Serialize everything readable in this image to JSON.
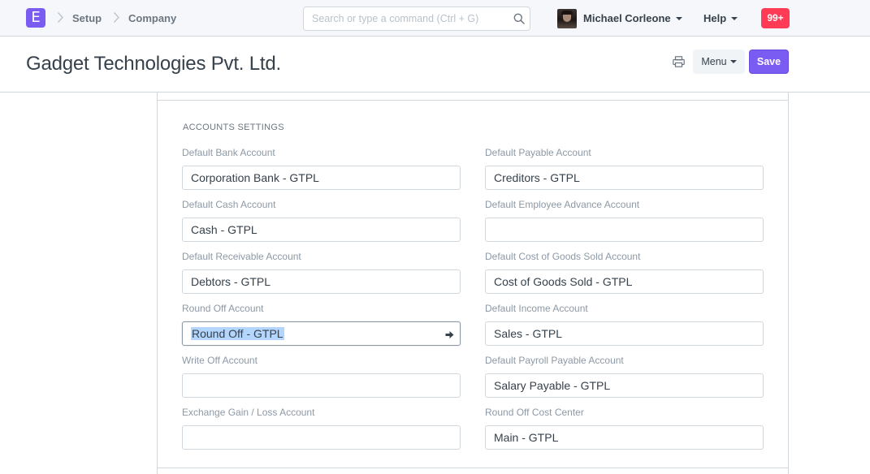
{
  "navbar": {
    "logo_letter": "E",
    "breadcrumbs": [
      "Setup",
      "Company"
    ],
    "search_placeholder": "Search or type a command (Ctrl + G)",
    "user_name": "Michael Corleone",
    "help_label": "Help",
    "notification_count": "99+"
  },
  "page": {
    "title": "Gadget Technologies Pvt. Ltd.",
    "menu_label": "Menu",
    "save_label": "Save"
  },
  "section": {
    "title": "ACCOUNTS SETTINGS",
    "left_fields": [
      {
        "label": "Default Bank Account",
        "value": "Corporation Bank - GTPL"
      },
      {
        "label": "Default Cash Account",
        "value": "Cash - GTPL"
      },
      {
        "label": "Default Receivable Account",
        "value": "Debtors - GTPL"
      },
      {
        "label": "Round Off Account",
        "value": "Round Off - GTPL"
      },
      {
        "label": "Write Off Account",
        "value": ""
      },
      {
        "label": "Exchange Gain / Loss Account",
        "value": ""
      }
    ],
    "right_fields": [
      {
        "label": "Default Payable Account",
        "value": "Creditors - GTPL"
      },
      {
        "label": "Default Employee Advance Account",
        "value": ""
      },
      {
        "label": "Default Cost of Goods Sold Account",
        "value": "Cost of Goods Sold - GTPL"
      },
      {
        "label": "Default Income Account",
        "value": "Sales - GTPL"
      },
      {
        "label": "Default Payroll Payable Account",
        "value": "Salary Payable - GTPL"
      },
      {
        "label": "Round Off Cost Center",
        "value": "Main - GTPL"
      }
    ]
  },
  "colors": {
    "brand": "#7b5cf2",
    "badge": "#ff3b55",
    "selection": "#b4d5fe"
  }
}
